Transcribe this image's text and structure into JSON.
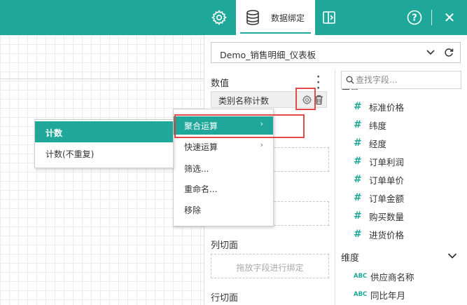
{
  "toolbar": {
    "bind_tab_label": "数据绑定",
    "help_label": "?",
    "close_label": "✕"
  },
  "panel": {
    "data_source": "Demo_销售明细_仪表板",
    "values_title": "数值",
    "value_chip": "类别名称计数",
    "column_slicer_title": "列切面",
    "row_slicer_title": "行切面",
    "drop_placeholder": "拖放字段进行绑定"
  },
  "fields": {
    "search_placeholder": "查找字段...",
    "measures_header_cut": "度量",
    "measures": [
      "标准价格",
      "纬度",
      "经度",
      "订单利润",
      "订单单价",
      "订单金额",
      "购买数量",
      "进货价格"
    ],
    "dimensions_header": "维度",
    "dimension_type_label": "ABC",
    "dimensions": [
      "供应商名称",
      "同比年月"
    ]
  },
  "context_menu": {
    "items": [
      {
        "label": "聚合运算",
        "submenu": true
      },
      {
        "label": "快速运算",
        "submenu": true
      },
      {
        "label": "筛选...",
        "submenu": false
      },
      {
        "label": "重命名...",
        "submenu": false
      },
      {
        "label": "移除",
        "submenu": false
      }
    ],
    "submenu_arrow": "›"
  },
  "aggregate_submenu": {
    "items": [
      "计数",
      "计数(不重复)"
    ]
  },
  "colors": {
    "accent": "#1fa89a",
    "highlight_border": "#e14a4a"
  }
}
